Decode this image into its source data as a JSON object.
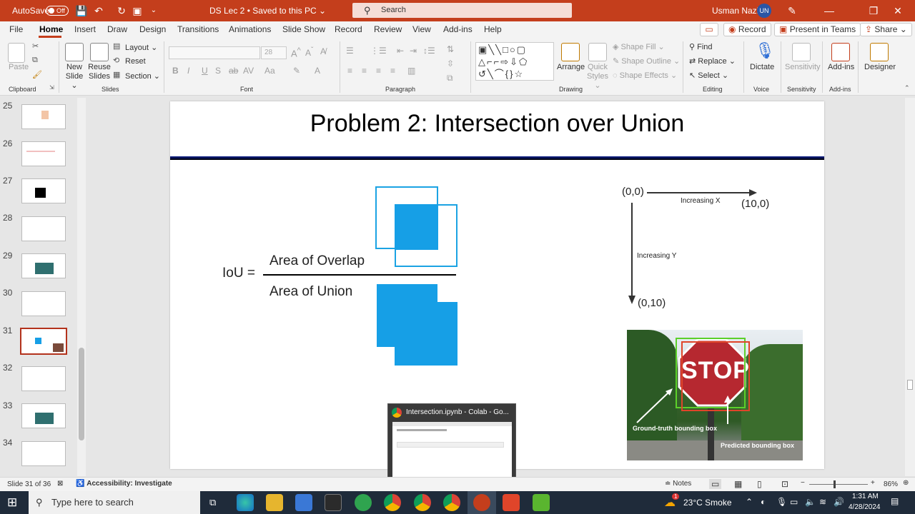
{
  "titlebar": {
    "autosave": "AutoSave",
    "autosave_state": "Off",
    "doc_title": "DS Lec 2 • Saved to this PC ⌄",
    "search_placeholder": "Search",
    "user_name": "Usman Nazir",
    "user_initials": "UN"
  },
  "menu": {
    "tabs": [
      "File",
      "Home",
      "Insert",
      "Draw",
      "Design",
      "Transitions",
      "Animations",
      "Slide Show",
      "Record",
      "Review",
      "View",
      "Add-ins",
      "Help"
    ],
    "record_btn": "Record",
    "present_btn": "Present in Teams",
    "share_btn": "Share"
  },
  "ribbon": {
    "groups": {
      "clipboard": "Clipboard",
      "slides": "Slides",
      "font": "Font",
      "paragraph": "Paragraph",
      "drawing": "Drawing",
      "editing": "Editing",
      "voice": "Voice",
      "sensitivity": "Sensitivity",
      "addins": "Add-ins"
    },
    "paste": "Paste",
    "new_slide": "New Slide ⌄",
    "reuse_slides": "Reuse Slides",
    "layout": "Layout ⌄",
    "reset": "Reset",
    "section": "Section ⌄",
    "font_size": "28",
    "arrange": "Arrange",
    "quick_styles": "Quick Styles ⌄",
    "shape_fill": "Shape Fill ⌄",
    "shape_outline": "Shape Outline ⌄",
    "shape_effects": "Shape Effects ⌄",
    "find": "Find",
    "replace": "Replace ⌄",
    "select": "Select ⌄",
    "dictate": "Dictate",
    "sensitivity": "Sensitivity",
    "addins": "Add-ins",
    "designer": "Designer"
  },
  "slides_panel": {
    "numbers": [
      "25",
      "26",
      "27",
      "28",
      "29",
      "30",
      "31",
      "32",
      "33",
      "34"
    ],
    "selected": "31"
  },
  "slide": {
    "title": "Problem 2: Intersection over Union",
    "iou_label": "IoU =",
    "numerator": "Area of Overlap",
    "denominator": "Area of Union",
    "origin": "(0,0)",
    "x_end": "(10,0)",
    "y_end": "(0,10)",
    "increasing_x": "Increasing X",
    "increasing_y": "Increasing Y",
    "stop_text": "STOP",
    "gt_label": "Ground-truth bounding box",
    "pred_label": "Predicted bounding box"
  },
  "popup": {
    "title": "Intersection.ipynb - Colab - Go..."
  },
  "statusbar": {
    "slide_info": "Slide 31 of 36",
    "accessibility": "Accessibility: Investigate",
    "notes": "Notes",
    "zoom": "86%"
  },
  "taskbar": {
    "search_placeholder": "Type here to search",
    "weather": "23°C  Smoke",
    "weather_badge": "1",
    "time": "1:31 AM",
    "date": "4/28/2024"
  },
  "colors": {
    "accent": "#c43e1c",
    "box_blue": "#169fe6",
    "outline_blue": "#1ba3e3",
    "title_rule": "#0b1f8f"
  }
}
